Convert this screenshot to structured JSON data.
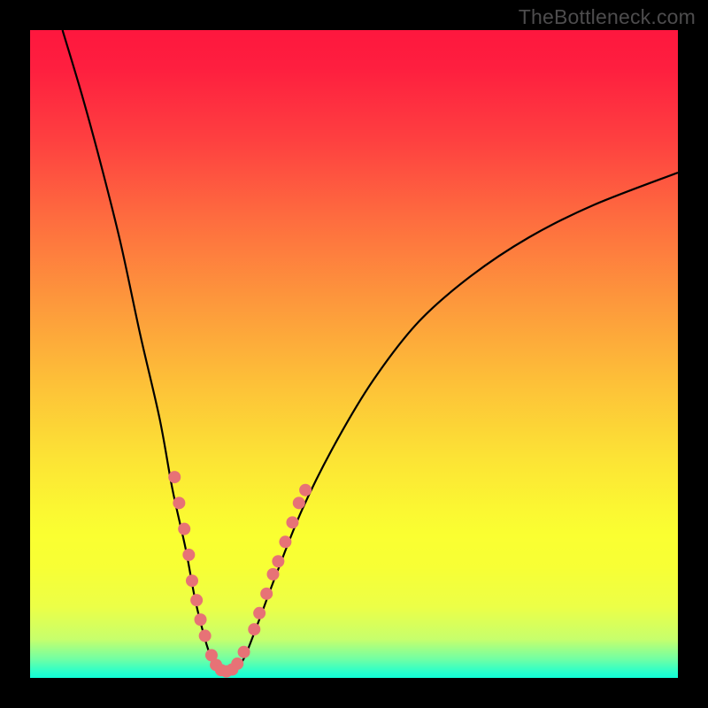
{
  "watermark": "TheBottleneck.com",
  "chart_data": {
    "type": "line",
    "title": "",
    "xlabel": "",
    "ylabel": "",
    "xlim": [
      0,
      100
    ],
    "ylim": [
      0,
      100
    ],
    "curve": {
      "name": "bottleneck-curve",
      "stroke": "#000000",
      "points": [
        {
          "x": 5,
          "y": 100
        },
        {
          "x": 8,
          "y": 90
        },
        {
          "x": 11,
          "y": 79
        },
        {
          "x": 14,
          "y": 67
        },
        {
          "x": 17,
          "y": 53
        },
        {
          "x": 20,
          "y": 40
        },
        {
          "x": 22,
          "y": 29
        },
        {
          "x": 24,
          "y": 20
        },
        {
          "x": 25.5,
          "y": 12
        },
        {
          "x": 27,
          "y": 6
        },
        {
          "x": 28,
          "y": 3
        },
        {
          "x": 29,
          "y": 1.2
        },
        {
          "x": 30.2,
          "y": 0.8
        },
        {
          "x": 31.5,
          "y": 1.2
        },
        {
          "x": 33,
          "y": 3
        },
        {
          "x": 35,
          "y": 8
        },
        {
          "x": 38,
          "y": 16
        },
        {
          "x": 42,
          "y": 26
        },
        {
          "x": 47,
          "y": 36
        },
        {
          "x": 53,
          "y": 46
        },
        {
          "x": 60,
          "y": 55
        },
        {
          "x": 68,
          "y": 62
        },
        {
          "x": 77,
          "y": 68
        },
        {
          "x": 87,
          "y": 73
        },
        {
          "x": 100,
          "y": 78
        }
      ]
    },
    "markers": {
      "name": "sample-points",
      "color": "#e77276",
      "radius": 7,
      "points": [
        {
          "x": 22.3,
          "y": 31
        },
        {
          "x": 23.0,
          "y": 27
        },
        {
          "x": 23.8,
          "y": 23
        },
        {
          "x": 24.5,
          "y": 19
        },
        {
          "x": 25.0,
          "y": 15
        },
        {
          "x": 25.7,
          "y": 12
        },
        {
          "x": 26.3,
          "y": 9
        },
        {
          "x": 27.0,
          "y": 6.5
        },
        {
          "x": 28.0,
          "y": 3.5
        },
        {
          "x": 28.7,
          "y": 2
        },
        {
          "x": 29.5,
          "y": 1.2
        },
        {
          "x": 30.3,
          "y": 1.0
        },
        {
          "x": 31.2,
          "y": 1.3
        },
        {
          "x": 32.0,
          "y": 2.2
        },
        {
          "x": 33.0,
          "y": 4
        },
        {
          "x": 34.6,
          "y": 7.5
        },
        {
          "x": 35.4,
          "y": 10
        },
        {
          "x": 36.5,
          "y": 13
        },
        {
          "x": 37.5,
          "y": 16
        },
        {
          "x": 38.3,
          "y": 18
        },
        {
          "x": 39.4,
          "y": 21
        },
        {
          "x": 40.5,
          "y": 24
        },
        {
          "x": 41.5,
          "y": 27
        },
        {
          "x": 42.5,
          "y": 29
        }
      ]
    }
  }
}
